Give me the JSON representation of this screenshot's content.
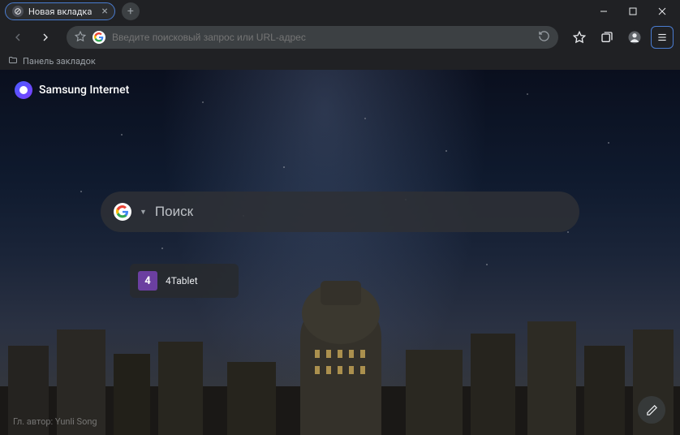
{
  "tab": {
    "title": "Новая вкладка"
  },
  "addressbar": {
    "placeholder": "Введите поисковый запрос или URL-адрес"
  },
  "bookmarks_bar": {
    "label": "Панель закладок"
  },
  "brand": {
    "name": "Samsung Internet"
  },
  "search": {
    "placeholder": "Поиск"
  },
  "shortcuts": [
    {
      "badge": "4",
      "label": "4Tablet"
    }
  ],
  "credit": "Гл. автор: Yunli Song",
  "colors": {
    "accent": "#4a7cd0",
    "shortcut_icon": "#6b3fa0"
  }
}
